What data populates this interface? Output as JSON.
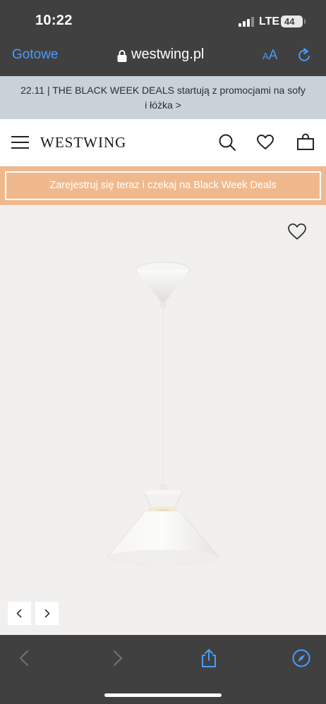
{
  "status_bar": {
    "time": "10:22",
    "network": "LTE",
    "battery": "44"
  },
  "browser": {
    "done_label": "Gotowe",
    "domain": "westwing.pl",
    "text_size_small": "A",
    "text_size_big": "A",
    "accent_color": "#4a9bff"
  },
  "promo": {
    "text": "22.11 | THE BLACK WEEK DEALS startują z promocjami na sofy i łóżka >"
  },
  "header": {
    "logo": "WESTWING",
    "icons": [
      "menu-icon",
      "search-icon",
      "heart-icon",
      "shopping-bag-icon"
    ]
  },
  "register": {
    "label": "Zarejestruj się teraz i czekaj na Black Week Deals",
    "strip_color": "#f0b98d"
  },
  "gallery": {
    "icons": [
      "wishlist-heart-icon",
      "chevron-left-icon",
      "chevron-right-icon"
    ]
  },
  "toolbar": {
    "icons": [
      "back-icon",
      "forward-icon",
      "share-icon",
      "compass-icon"
    ]
  }
}
